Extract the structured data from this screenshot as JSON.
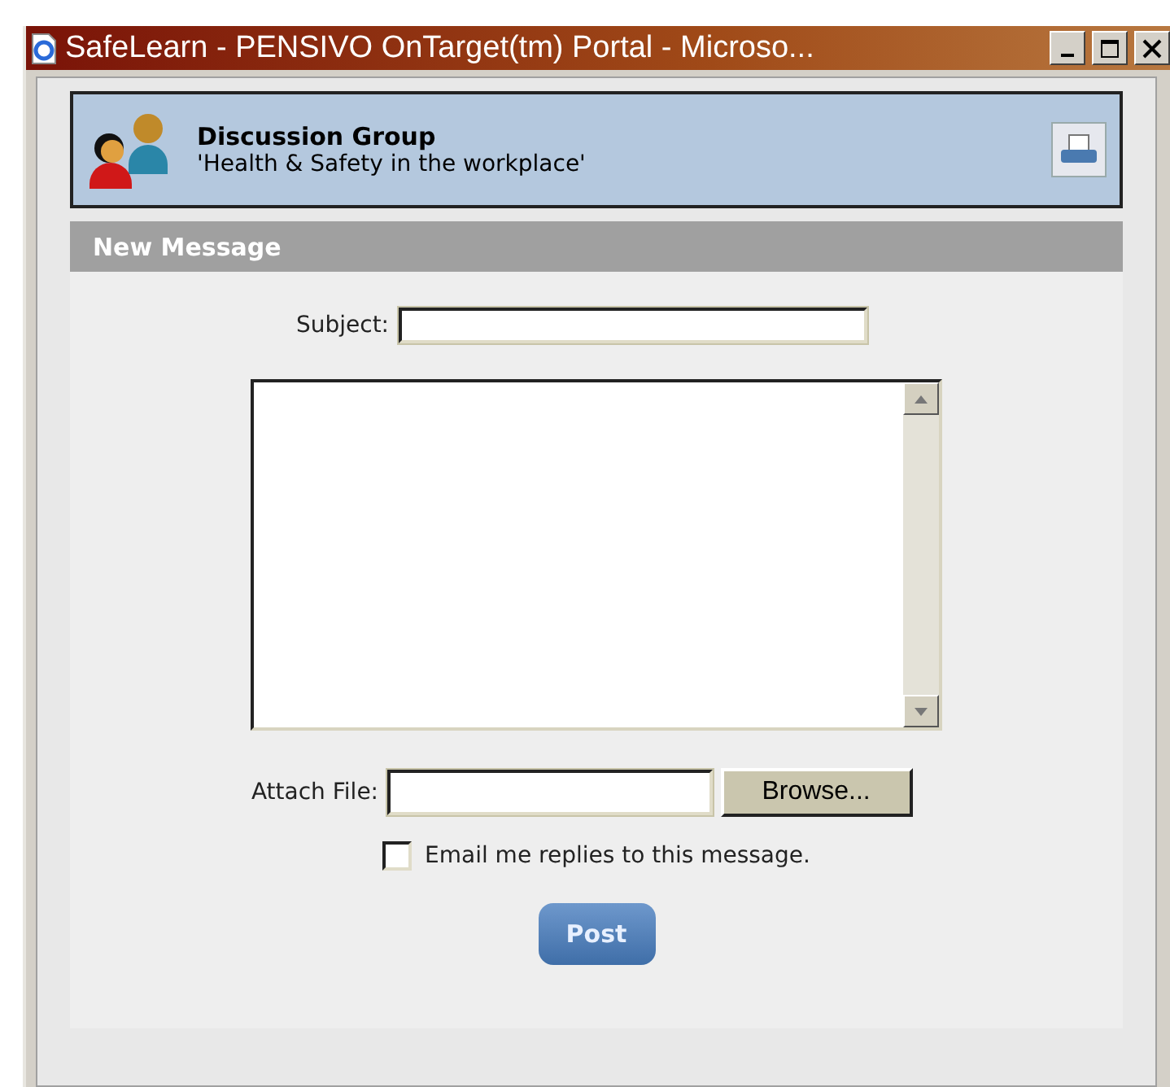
{
  "window": {
    "title": "SafeLearn - PENSIVO OnTarget(tm) Portal - Microso..."
  },
  "header": {
    "title": "Discussion Group",
    "subtitle": "'Health & Safety in the workplace'"
  },
  "section": {
    "title": "New Message"
  },
  "form": {
    "subject_label": "Subject:",
    "attach_label": "Attach File:",
    "browse_button": "Browse...",
    "email_replies": {
      "label": "Email me replies to this message.",
      "checked": false
    },
    "post_button": "Post"
  }
}
